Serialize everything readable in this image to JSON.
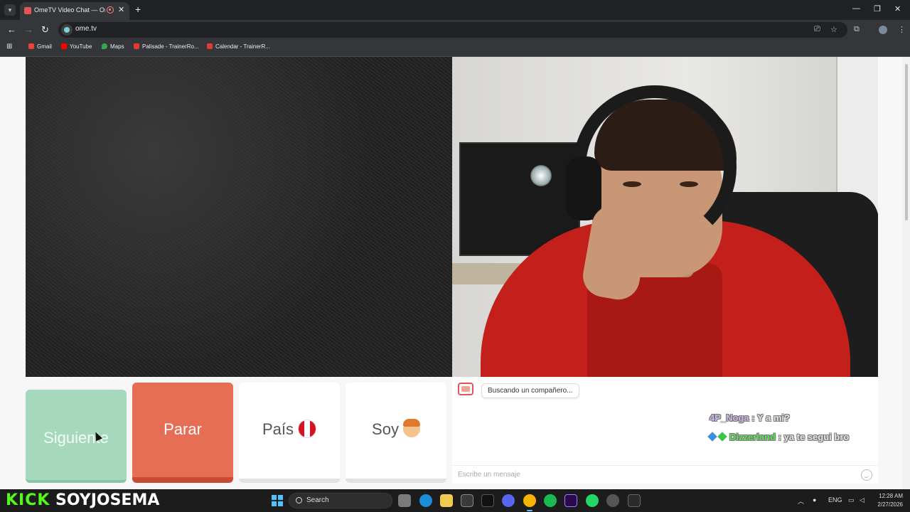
{
  "browser": {
    "tab_title": "OmeTV Video Chat — Ome",
    "tab_close": "✕",
    "new_tab": "+",
    "url": "ome.tv",
    "window_controls": {
      "minimize": "—",
      "maximize": "❐",
      "close": "✕"
    },
    "bookmarks": [
      {
        "label": "Gmail",
        "icon": "gmail-icon",
        "color": "#ea4335"
      },
      {
        "label": "YouTube",
        "icon": "youtube-icon",
        "color": "#ff0000"
      },
      {
        "label": "Maps",
        "icon": "maps-icon",
        "color": "#34a853"
      },
      {
        "label": "Palisade - TrainerRo...",
        "icon": "trainerroad-icon",
        "color": "#e53935"
      },
      {
        "label": "Calendar - TrainerR...",
        "icon": "trainerroad-icon",
        "color": "#e53935"
      }
    ]
  },
  "controls": {
    "next_label": "Siguiente",
    "stop_label": "Parar",
    "country_label": "País",
    "country_flag": "peru-flag",
    "gender_label": "Soy",
    "gender_icon": "boy-face-icon"
  },
  "chat": {
    "status": "Buscando un compañero...",
    "overlay_messages": [
      {
        "user": "4P_Noga",
        "separator": " : ",
        "text": "Y a mi?"
      },
      {
        "user": "Dizzerland",
        "separator": " : ",
        "text": "ya te segui bro"
      }
    ],
    "input_placeholder": "Escribe un mensaje"
  },
  "stream_overlay": {
    "platform": "KICK",
    "username": "SOYJOSEMA"
  },
  "taskbar": {
    "search_label": "Search",
    "language": "ENG",
    "time": "12:28 AM",
    "date": "2/27/2026"
  },
  "colors": {
    "next": "#a6d8bd",
    "stop": "#e66e55",
    "kick_green": "#53fc18",
    "accent": "#4cc2ff"
  }
}
